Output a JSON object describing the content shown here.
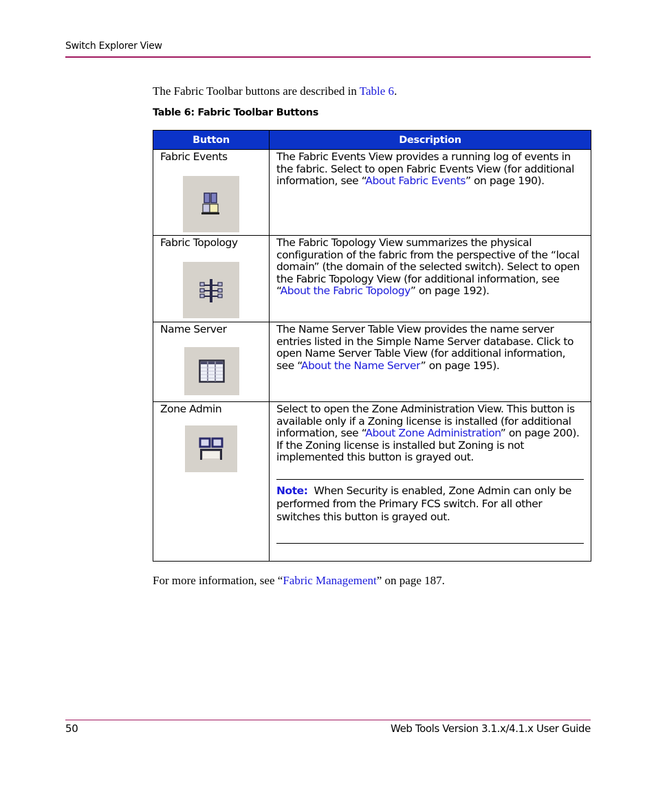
{
  "header": {
    "running_head": "Switch Explorer View",
    "rule_color": "#a0185f"
  },
  "intro": {
    "text_before": "The Fabric Toolbar buttons are described in ",
    "link": "Table 6",
    "text_after": "."
  },
  "table": {
    "caption": "Table 6:  Fabric Toolbar Buttons",
    "header_color": "#0b33c8",
    "columns": [
      "Button",
      "Description"
    ],
    "rows": [
      {
        "button": "Fabric Events",
        "icon": "fabric-events-icon",
        "desc_before": "The Fabric Events View provides a running log of events in the fabric. Select to open Fabric Events View (for additional information, see “",
        "desc_link": "About Fabric Events",
        "desc_after": "” on page 190)."
      },
      {
        "button": "Fabric Topology",
        "icon": "fabric-topology-icon",
        "desc_before": "The Fabric Topology View summarizes the physical configuration of the fabric from the perspective of the “local domain” (the domain of the selected switch). Select to open the Fabric Topology View (for additional information, see “",
        "desc_link": "About the Fabric Topology",
        "desc_after": "” on page 192)."
      },
      {
        "button": "Name Server",
        "icon": "name-server-table-icon",
        "desc_before": "The Name Server Table View provides the name server entries listed in the Simple Name Server database. Click to open Name Server Table View (for additional information, see “",
        "desc_link": "About the Name Server",
        "desc_after": "” on page 195)."
      },
      {
        "button": "Zone Admin",
        "icon": "zone-admin-icon",
        "desc_before": "Select to open the Zone Administration View. This button is available only if a Zoning license is installed (for additional information, see “",
        "desc_link": "About Zone Administration",
        "desc_after": "” on page 200). If the Zoning license is installed but Zoning is not implemented this button is grayed out.",
        "note_label": "Note:",
        "note_text": "When Security is enabled, Zone Admin can only be performed from the Primary FCS switch. For all other switches this button is grayed out."
      }
    ]
  },
  "more_info": {
    "text_before": "For more information, see “",
    "link": "Fabric Management",
    "text_after": "” on page 187."
  },
  "footer": {
    "page_number": "50",
    "guide_title": "Web Tools Version 3.1.x/4.1.x User Guide"
  }
}
